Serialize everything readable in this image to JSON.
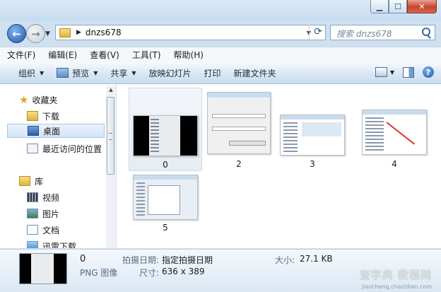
{
  "address": {
    "breadcrumb": "dnzs678"
  },
  "search": {
    "placeholder": "搜索 dnzs678"
  },
  "menu": [
    "文件(F)",
    "编辑(E)",
    "查看(V)",
    "工具(T)",
    "帮助(H)"
  ],
  "toolbar": {
    "organize": "组织",
    "preview": "预览",
    "share": "共享",
    "slideshow": "放映幻灯片",
    "print": "打印",
    "new_folder": "新建文件夹"
  },
  "nav": {
    "favorites": "收藏夹",
    "downloads": "下载",
    "desktop": "桌面",
    "recent": "最近访问的位置",
    "libraries": "库",
    "videos": "视频",
    "pictures": "图片",
    "documents": "文档",
    "xunlei": "迅雷下载"
  },
  "files": [
    {
      "name": "0"
    },
    {
      "name": "2"
    },
    {
      "name": "3"
    },
    {
      "name": "4"
    },
    {
      "name": "5"
    }
  ],
  "details": {
    "name": "0",
    "type": "PNG 图像",
    "date_label": "拍摄日期:",
    "date_value": "指定拍摄日期",
    "dim_label": "尺寸:",
    "dim_value": "636 x 389",
    "size_label": "大小:",
    "size_value": "27.1 KB"
  },
  "watermark": {
    "big": "查字典 教程网",
    "small": "jiaocheng.chazidian.com"
  },
  "colors": {
    "selection": "#d4e5f7",
    "window_frame": "#cfe0f1",
    "accent": "#2458a8"
  }
}
